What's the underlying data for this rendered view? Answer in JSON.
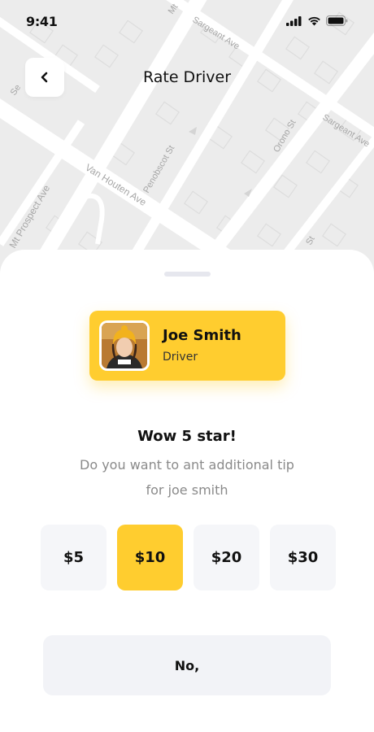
{
  "status_bar": {
    "time": "9:41"
  },
  "header": {
    "title": "Rate Driver"
  },
  "map": {
    "street_labels": [
      "Mt",
      "Sargeant Ave",
      "Se",
      "Penobscot St",
      "Orono St",
      "Sargeant Ave",
      "Van Houten Ave",
      "Mt Prospect Ave",
      "St"
    ]
  },
  "driver": {
    "name": "Joe Smith",
    "role": "Driver"
  },
  "rating": {
    "title": "Wow 5 star!",
    "subtitle_line1": "Do you want to ant additional tip",
    "subtitle_line2": "for joe smith"
  },
  "tips": [
    {
      "label": "$5",
      "selected": false
    },
    {
      "label": "$10",
      "selected": true
    },
    {
      "label": "$20",
      "selected": false
    },
    {
      "label": "$30",
      "selected": false
    }
  ],
  "actions": {
    "no_label": "No,"
  },
  "colors": {
    "accent": "#FFCD2F",
    "tile_bg": "#F5F6F9",
    "button_bg": "#F2F3F7",
    "map_bg": "#ECECEC"
  }
}
